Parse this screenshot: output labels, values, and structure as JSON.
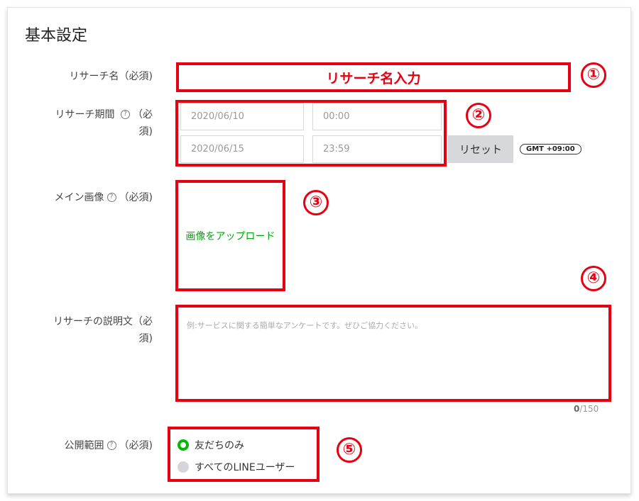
{
  "section": {
    "title": "基本設定"
  },
  "fields": {
    "research_name": {
      "label": "リサーチ名（必須)",
      "value": "リサーチ名入力",
      "badge": "①"
    },
    "research_period": {
      "label_line1": "リサーチ期間 ",
      "label_line2": "（必",
      "label_line3": "須)",
      "help": "?",
      "start_date": "2020/06/10",
      "start_time": "00:00",
      "end_date": "2020/06/15",
      "end_time": "23:59",
      "reset_label": "リセット",
      "timezone": "GMT +09:00",
      "badge": "②"
    },
    "main_image": {
      "label_a": "メイン画像",
      "label_b": "（必須)",
      "help": "?",
      "upload_label": "画像をアップロード",
      "badge": "③"
    },
    "description": {
      "label_line1": "リサーチの説明文（必",
      "label_line2": "須)",
      "placeholder": "例:サービスに関する簡単なアンケートです。ぜひご協力ください。",
      "count_current": "0",
      "count_max": "/150",
      "badge": "④"
    },
    "visibility": {
      "label_a": "公開範囲",
      "label_b": "（必須)",
      "help": "?",
      "options": [
        {
          "label": "友だちのみ",
          "selected": true
        },
        {
          "label": "すべてのLINEユーザー",
          "selected": false
        }
      ],
      "badge": "⑤"
    }
  },
  "colors": {
    "annotation": "#e60012",
    "line_green": "#00b900",
    "upload_green": "#00a80a"
  }
}
